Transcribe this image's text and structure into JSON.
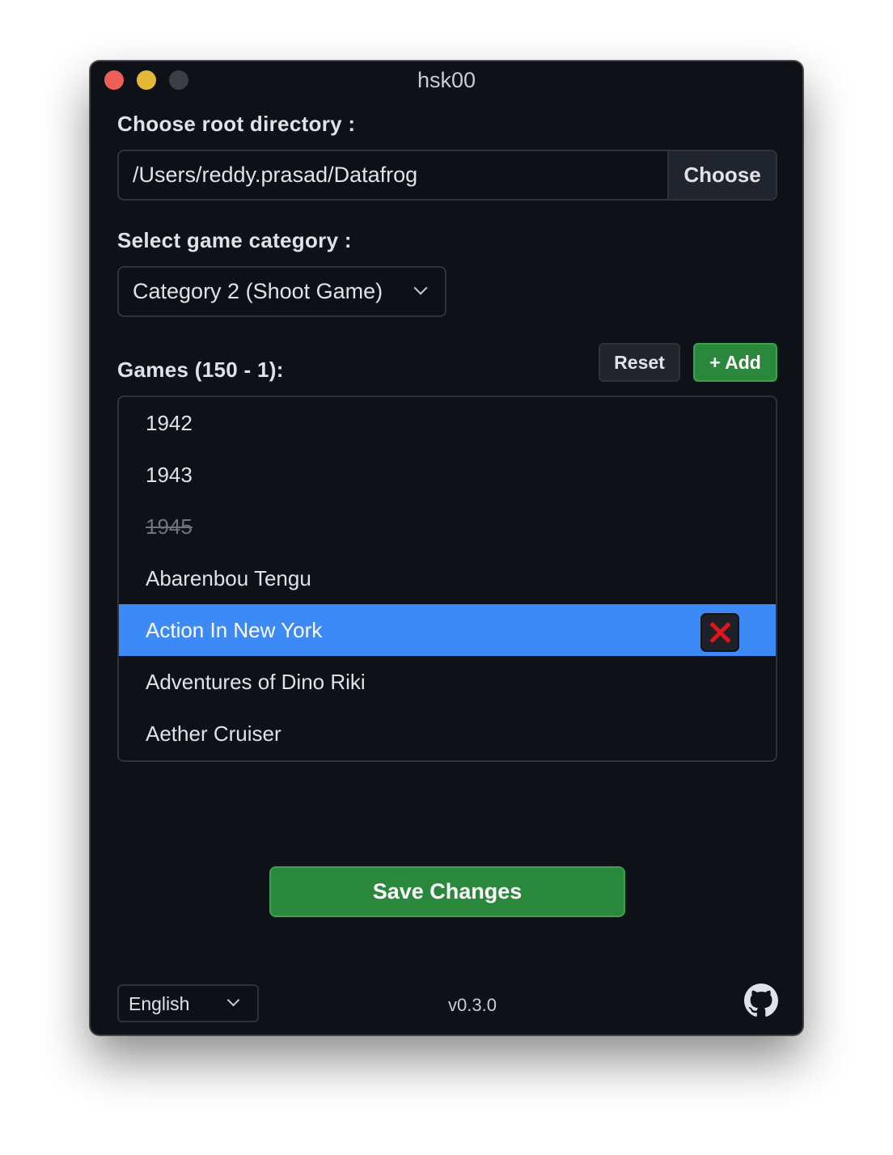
{
  "window": {
    "title": "hsk00"
  },
  "root_directory": {
    "label": "Choose root directory :",
    "path": "/Users/reddy.prasad/Datafrog",
    "choose_label": "Choose"
  },
  "category": {
    "label": "Select game category :",
    "selected": "Category 2 (Shoot Game)"
  },
  "games": {
    "label": "Games (150 - 1):",
    "reset_label": "Reset",
    "add_label": "+ Add",
    "items": [
      {
        "name": "1942"
      },
      {
        "name": "1943"
      },
      {
        "name": "1945",
        "deleted": true
      },
      {
        "name": "Abarenbou Tengu"
      },
      {
        "name": "Action In New York",
        "selected": true
      },
      {
        "name": "Adventures of Dino Riki"
      },
      {
        "name": "Aether Cruiser"
      }
    ]
  },
  "save_label": "Save Changes",
  "footer": {
    "language": "English",
    "version": "v0.3.0",
    "icon": "github-icon"
  },
  "colors": {
    "background": "#0e1118",
    "accent_green": "#2a883d",
    "selection_blue": "#3d8af7",
    "delete_red": "#e0161b"
  }
}
